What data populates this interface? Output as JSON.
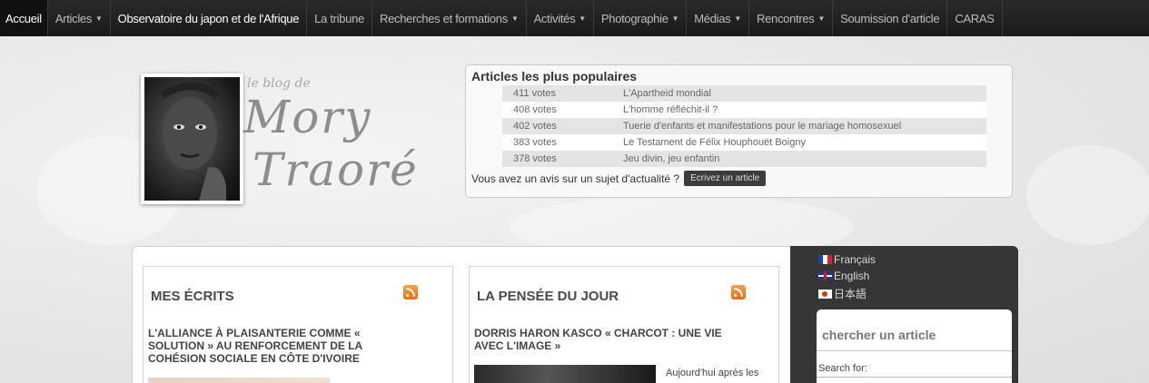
{
  "nav": {
    "items": [
      {
        "label": "Accueil",
        "dropdown": false
      },
      {
        "label": "Articles",
        "dropdown": true
      },
      {
        "label": "Observatoire du japon et de l'Afrique",
        "dropdown": false
      },
      {
        "label": "La tribune",
        "dropdown": false
      },
      {
        "label": "Recherches et formations",
        "dropdown": true
      },
      {
        "label": "Activités",
        "dropdown": true
      },
      {
        "label": "Photographie",
        "dropdown": true
      },
      {
        "label": "Médias",
        "dropdown": true
      },
      {
        "label": "Rencontres",
        "dropdown": true
      },
      {
        "label": "Soumission d'article",
        "dropdown": false
      },
      {
        "label": "CARAS",
        "dropdown": false
      }
    ]
  },
  "logo": {
    "small": "le blog de",
    "line1": "Mory",
    "line2": "Traoré"
  },
  "popular": {
    "title": "Articles les plus populaires",
    "rows": [
      {
        "votes": "411 votes",
        "title": "L'Apartheid mondial"
      },
      {
        "votes": "408 votes",
        "title": "L'homme réfléchit-il ?"
      },
      {
        "votes": "402 votes",
        "title": "Tuerie d'enfants et manifestations pour le mariage homosexuel"
      },
      {
        "votes": "383 votes",
        "title": "Le Testament de Félix Houphouët Boigny"
      },
      {
        "votes": "378 votes",
        "title": "Jeu divin, jeu enfantin"
      }
    ],
    "opinion_text": "Vous avez un avis sur un sujet d'actualité ?",
    "write_button": "Ecrivez un article"
  },
  "columns": {
    "left": {
      "heading": "MES ÉCRITS",
      "article_title": "L'ALLIANCE À PLAISANTERIE COMME « SOLUTION » AU RENFORCEMENT DE LA COHÉSION SOCIALE EN CÔTE D'IVOIRE"
    },
    "right": {
      "heading": "LA PENSÉE DU JOUR",
      "article_title": "DORRIS HARON KASCO « CHARCOT : UNE VIE AVEC L'IMAGE »",
      "snippet": "Aujourd'hui après les"
    }
  },
  "sidebar": {
    "languages": [
      "Français",
      "English",
      "日本語"
    ],
    "search_title": "chercher un article",
    "search_label": "Search for:"
  },
  "colors": {
    "nav_bg": "#1f1f1f",
    "sidebar_bg": "#363636",
    "rss": "#f08a2a"
  }
}
